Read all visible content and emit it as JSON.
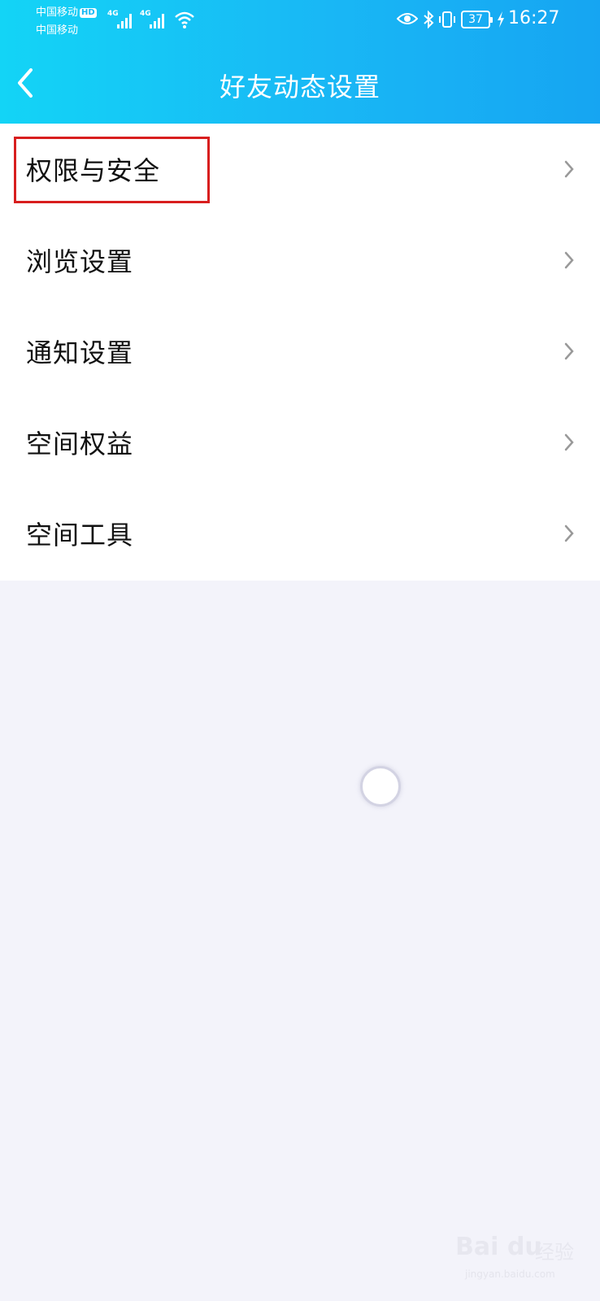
{
  "status_bar": {
    "carrier_1": "中国移动",
    "hd_badge": "HD",
    "carrier_2": "中国移动",
    "network_1": "4G",
    "network_2": "4G",
    "battery": "37",
    "time": "16:27"
  },
  "nav": {
    "title": "好友动态设置",
    "back_icon": "chevron-left-icon"
  },
  "menu": {
    "items": [
      {
        "label": "权限与安全",
        "icon": "chevron-right-icon"
      },
      {
        "label": "浏览设置",
        "icon": "chevron-right-icon"
      },
      {
        "label": "通知设置",
        "icon": "chevron-right-icon"
      },
      {
        "label": "空间权益",
        "icon": "chevron-right-icon"
      },
      {
        "label": "空间工具",
        "icon": "chevron-right-icon"
      }
    ]
  },
  "watermark": {
    "logo": "Bai du",
    "text": "经验",
    "url": "jingyan.baidu.com"
  },
  "colors": {
    "header_start": "#13d4f6",
    "header_end": "#16a5f2",
    "highlight": "#d81e1e",
    "background": "#f3f3fa"
  }
}
